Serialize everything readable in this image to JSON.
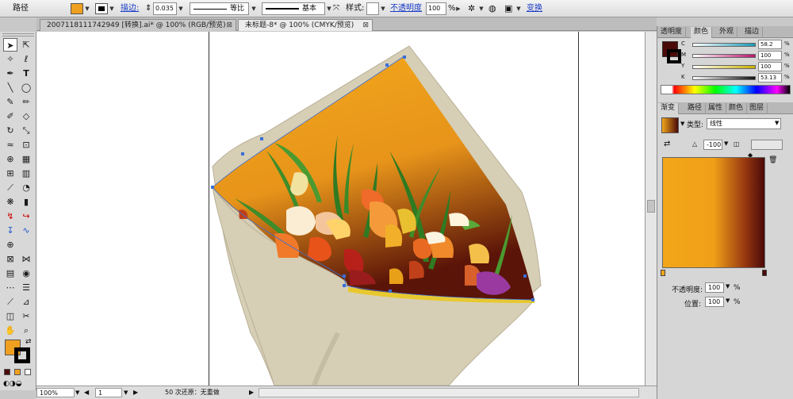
{
  "control_bar": {
    "object_type": "路径",
    "stroke_label": "描边:",
    "stroke_weight": "0.035",
    "profile_label": "等比",
    "brush_label": "基本",
    "style_label": "样式:",
    "opacity_label": "不透明度",
    "opacity_value": "100",
    "opacity_unit": "%",
    "transform_label": "变换"
  },
  "tabs": [
    {
      "label": "2007118111742949  [转换].ai* @ 100% (RGB/预览)",
      "close": "⊠"
    },
    {
      "label": "未标题-8* @ 100% (CMYK/预览)",
      "close": "⊠"
    }
  ],
  "status_bar": {
    "zoom": "100%",
    "page": "1",
    "undo_text": "50 次还原：无重做"
  },
  "color_panel": {
    "tabs": [
      "透明度",
      "颜色",
      "外观",
      "描边"
    ],
    "active_tab": "颜色",
    "channels": [
      {
        "name": "C",
        "value": "58.2",
        "color": "#1a9ab5",
        "level": 0.58
      },
      {
        "name": "M",
        "value": "100",
        "color": "#b8156e",
        "level": 1.0
      },
      {
        "name": "Y",
        "value": "100",
        "color": "#c9b000",
        "level": 1.0
      },
      {
        "name": "K",
        "value": "53.13",
        "color": "#111111",
        "level": 0.53
      }
    ],
    "unit": "%",
    "fill_color": "#4a0a0a"
  },
  "gradient_panel": {
    "tabs": [
      "渐变",
      "路径",
      "属性",
      "颜色",
      "图层"
    ],
    "active_tab": "渐变",
    "type_label": "类型:",
    "type_value": "线性",
    "angle_value": "-100",
    "opacity_label": "不透明度:",
    "opacity_value": "100",
    "position_label": "位置:",
    "position_value": "100",
    "unit": "%",
    "stop_start": "#f2a618",
    "stop_end": "#4a0a0a"
  },
  "colors": {
    "wrap": "#d6cfb6",
    "wrap_edge": "#b9af96",
    "bouquet_top": "#f3a81c",
    "bouquet_bottom": "#5a1408",
    "fill_swatch": "#f0a020"
  }
}
